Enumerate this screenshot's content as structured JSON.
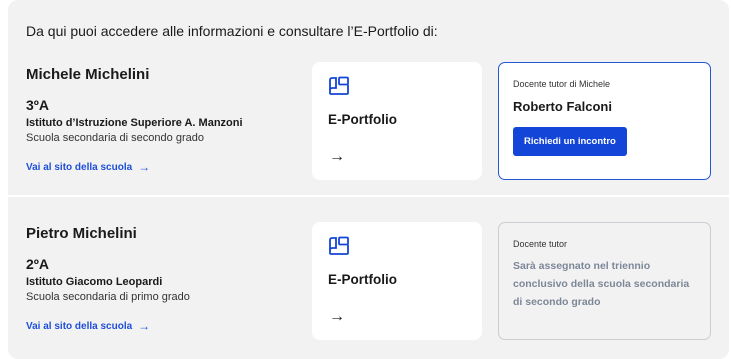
{
  "intro": "Da qui puoi accedere alle informazioni e consultare l’E-Portfolio di:",
  "students": [
    {
      "name": "Michele Michelini",
      "class": "3ºA",
      "school": "Istituto d’Istruzione Superiore A. Manzoni",
      "school_type": "Scuola secondaria di secondo grado",
      "site_link": "Vai al sito della scuola",
      "eportfolio_label": "E-Portfolio",
      "tutor_caption": "Docente tutor di Michele",
      "tutor_name": "Roberto Falconi",
      "tutor_button": "Richiedi un incontro"
    },
    {
      "name": "Pietro Michelini",
      "class": "2ºA",
      "school": "Istituto Giacomo Leopardi",
      "school_type": "Scuola secondaria di primo grado",
      "site_link": "Vai al sito della scuola",
      "eportfolio_label": "E-Portfolio",
      "tutor_caption": "Docente tutor",
      "tutor_message": "Sarà assegnato nel triennio conclusivo della scuola secondaria di secondo grado"
    }
  ],
  "icons": {
    "link_arrow": "arrow-right-icon",
    "eportfolio": "portfolio-book-icon",
    "card_arrow": "arrow-right-icon"
  },
  "colors": {
    "accent": "#1346d8",
    "link": "#1d4fd8",
    "muted_text": "#7c8798",
    "panel_bg": "#f2f2f2"
  }
}
